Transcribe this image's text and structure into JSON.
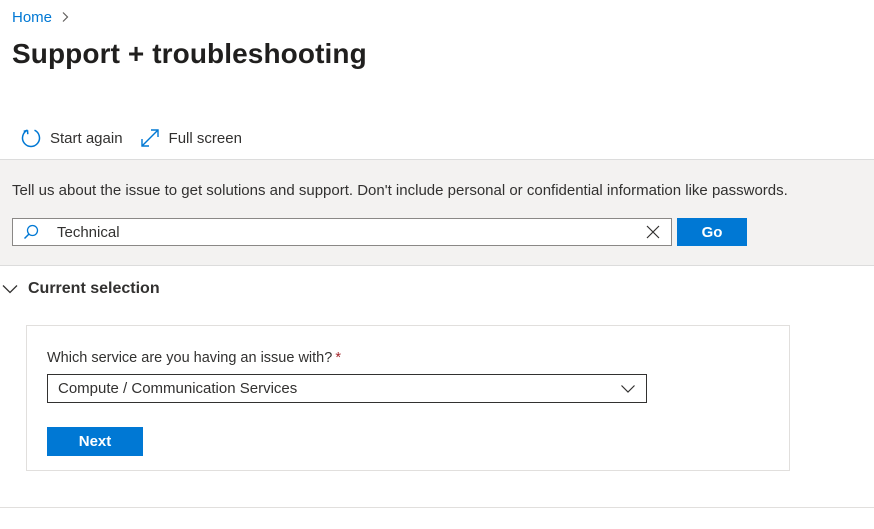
{
  "breadcrumb": {
    "home_label": "Home"
  },
  "page": {
    "title": "Support + troubleshooting"
  },
  "toolbar": {
    "start_again_label": "Start again",
    "start_again_icon": "refresh-icon",
    "full_screen_label": "Full screen",
    "full_screen_icon": "expand-icon"
  },
  "issue": {
    "instructions": "Tell us about the issue to get solutions and support. Don't include personal or confidential information like passwords.",
    "search_value": "Technical",
    "search_icon": "search-icon",
    "clear_icon": "close-icon",
    "go_label": "Go"
  },
  "current_selection": {
    "header_label": "Current selection",
    "service_question": "Which service are you having an issue with?",
    "required_marker": "*",
    "selected_service": "Compute / Communication Services",
    "next_label": "Next"
  },
  "colors": {
    "accent": "#0078d4",
    "panel_bg": "#f3f2f1",
    "required": "#a4262c",
    "text": "#323130"
  }
}
